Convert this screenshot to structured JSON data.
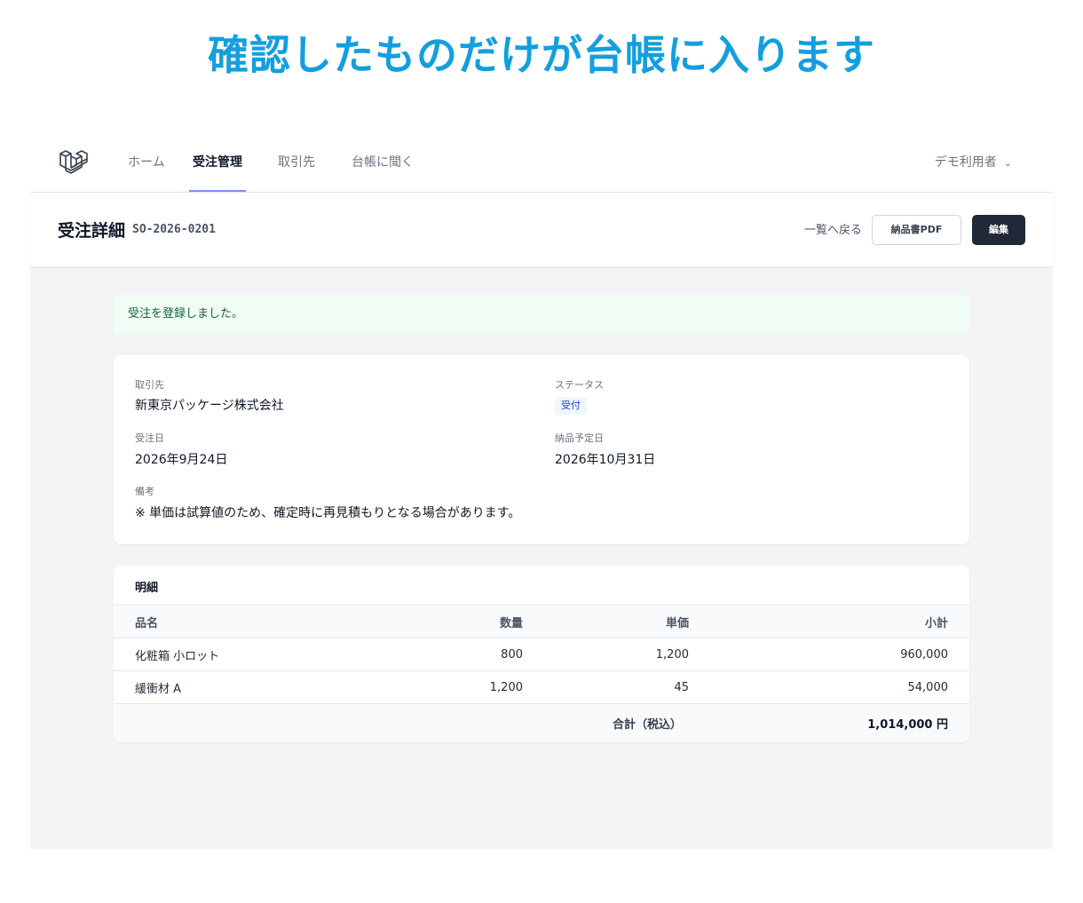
{
  "headline": "確認したものだけが台帳に入ります",
  "nav": {
    "links": [
      "ホーム",
      "受注管理",
      "取引先",
      "台帳に聞く"
    ],
    "user": "デモ利用者"
  },
  "header": {
    "title": "受注詳細",
    "order_no": "SO-2026-0201",
    "back_label": "一覧へ戻る",
    "pdf_label": "納品書PDF",
    "edit_label": "編集"
  },
  "flash": "受注を登録しました。",
  "info": {
    "client_label": "取引先",
    "client": "新東京パッケージ株式会社",
    "status_label": "ステータス",
    "status": "受付",
    "order_date_label": "受注日",
    "order_date": "2026年9月24日",
    "delivery_label": "納品予定日",
    "delivery_date": "2026年10月31日",
    "note_label": "備考",
    "note": "※ 単価は試算値のため、確定時に再見積もりとなる場合があります。"
  },
  "items": {
    "title": "明細",
    "columns": [
      "品名",
      "数量",
      "単価",
      "小計"
    ],
    "rows": [
      {
        "name": "化粧箱 小ロット",
        "qty": "800",
        "price": "1,200",
        "subtotal": "960,000"
      },
      {
        "name": "緩衝材 A",
        "qty": "1,200",
        "price": "45",
        "subtotal": "54,000"
      }
    ],
    "total_label": "合計（税込）",
    "total": "1,014,000 円"
  },
  "colors": {
    "headline": "#139fde",
    "active_underline": "#818cf8",
    "edit_button": "#1f2937",
    "flash_bg": "#f0fdf4"
  }
}
